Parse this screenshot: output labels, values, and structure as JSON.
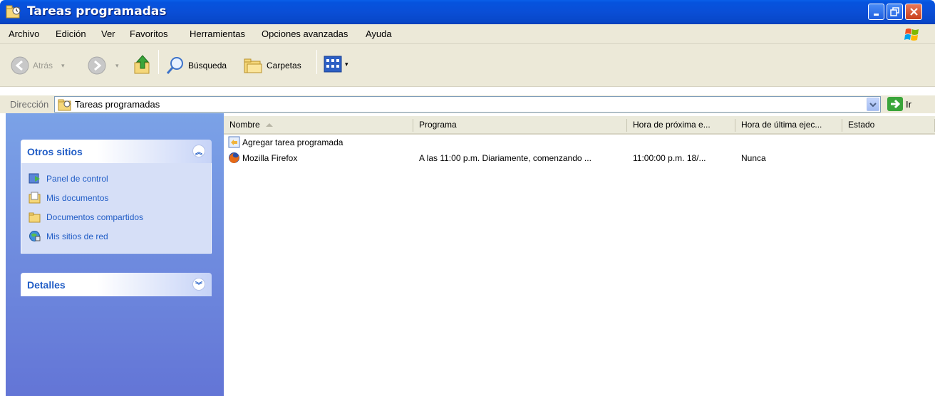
{
  "window": {
    "title": "Tareas programadas"
  },
  "menubar": {
    "items": [
      "Archivo",
      "Edición",
      "Ver",
      "Favoritos",
      "Herramientas",
      "Opciones avanzadas",
      "Ayuda"
    ]
  },
  "toolbar": {
    "back_label": "Atrás",
    "search_label": "Búsqueda",
    "folders_label": "Carpetas"
  },
  "address": {
    "label": "Dirección",
    "value": "Tareas programadas",
    "go_label": "Ir"
  },
  "sidebar": {
    "other_places": {
      "title": "Otros sitios",
      "items": [
        {
          "label": "Panel de control",
          "icon": "control-panel-icon"
        },
        {
          "label": "Mis documentos",
          "icon": "my-documents-icon"
        },
        {
          "label": "Documentos compartidos",
          "icon": "shared-folder-icon"
        },
        {
          "label": "Mis sitios de red",
          "icon": "network-places-icon"
        }
      ]
    },
    "details": {
      "title": "Detalles"
    }
  },
  "list": {
    "columns": [
      "Nombre",
      "Programa",
      "Hora de próxima e...",
      "Hora de última ejec...",
      "Estado"
    ],
    "rows": [
      {
        "name": "Agregar tarea programada",
        "icon": "add-task-icon",
        "program": "",
        "next_run": "",
        "last_run": "",
        "status": ""
      },
      {
        "name": "Mozilla Firefox",
        "icon": "firefox-icon",
        "program": "A las 11:00 p.m. Diariamente, comenzando ...",
        "next_run": "11:00:00 p.m. 18/...",
        "last_run": "Nunca",
        "status": ""
      }
    ]
  },
  "colors": {
    "titlebar": "#0a4ed6",
    "sidebar_bg": "#6f8fdf",
    "link": "#215dc6",
    "chrome": "#ece9d8"
  }
}
